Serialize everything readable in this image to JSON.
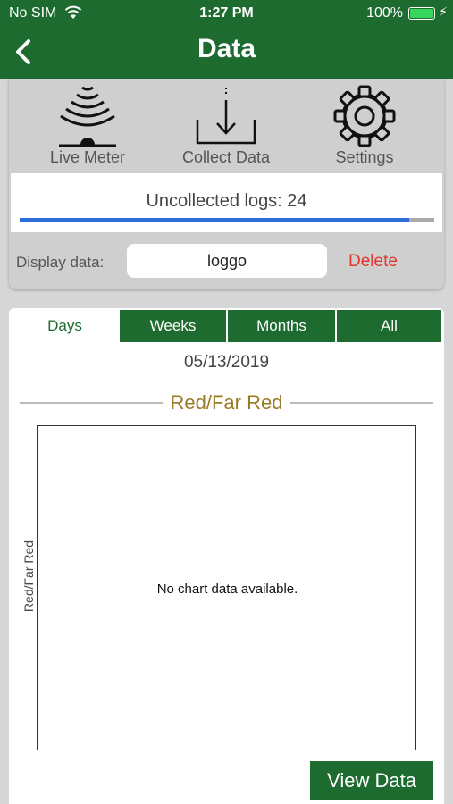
{
  "status_bar": {
    "carrier": "No SIM",
    "time": "1:27 PM",
    "battery": "100%",
    "battery_level": 1.0
  },
  "nav": {
    "title": "Data",
    "back_icon": "chevron-left-icon"
  },
  "tools": [
    {
      "label": "Live Meter",
      "icon": "signal-meter-icon"
    },
    {
      "label": "Collect Data",
      "icon": "download-icon"
    },
    {
      "label": "Settings",
      "icon": "gear-icon"
    }
  ],
  "logs": {
    "label": "Uncollected logs: 24",
    "progress": 0.94
  },
  "display": {
    "label": "Display data:",
    "value": "loggo",
    "delete_label": "Delete"
  },
  "tabs": [
    {
      "label": "Days",
      "active": true
    },
    {
      "label": "Weeks",
      "active": false
    },
    {
      "label": "Months",
      "active": false
    },
    {
      "label": "All",
      "active": false
    }
  ],
  "date": "05/13/2019",
  "chart": {
    "title": "Red/Far Red",
    "ylabel": "Red/Far Red",
    "empty_message": "No chart data available."
  },
  "view_data_label": "View Data",
  "colors": {
    "brand_green": "#1e6b30",
    "delete_red": "#e0352b",
    "chart_title_gold": "#9a7b25",
    "progress_blue": "#2d6fd6"
  }
}
